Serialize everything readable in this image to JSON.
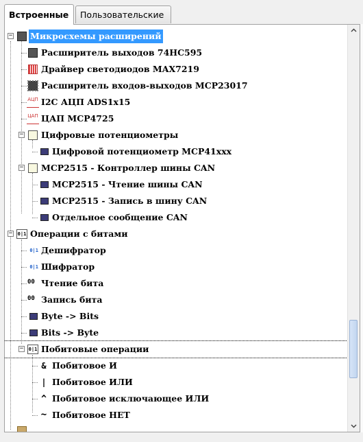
{
  "tabs": [
    {
      "label": "Встроенные",
      "active": true
    },
    {
      "label": "Пользовательские",
      "active": false
    }
  ],
  "tree": {
    "items": [
      {
        "label": "Микросхемы расширений",
        "icon": "chip-group-icon",
        "expanded": true
      },
      {
        "label": "Расширитель выходов 74HC595",
        "icon": "chip-icon"
      },
      {
        "label": "Драйвер светодиодов MAX7219",
        "icon": "led-matrix-icon"
      },
      {
        "label": "Расширитель входов-выходов MCP23017",
        "icon": "chip-icon"
      },
      {
        "label": "I2C АЦП ADS1x15",
        "icon": "adc-icon",
        "icon_text": "АЦП"
      },
      {
        "label": "ЦАП MCP4725",
        "icon": "dac-icon",
        "icon_text": "ЦАП"
      },
      {
        "label": "Цифровые потенциометры",
        "icon": "folder-icon",
        "expanded": true
      },
      {
        "label": "Цифровой потенциометр MCP41xxx",
        "icon": "block-icon"
      },
      {
        "label": "MCP2515 - Контроллер шины CAN",
        "icon": "folder-icon",
        "expanded": true
      },
      {
        "label": "MCP2515 - Чтение шины CAN",
        "icon": "block-icon"
      },
      {
        "label": "MCP2515 - Запись в шину CAN",
        "icon": "block-icon"
      },
      {
        "label": "Отдельное сообщение CAN",
        "icon": "block-icon"
      },
      {
        "label": "Операции с битами",
        "icon": "bits-group-icon",
        "expanded": true
      },
      {
        "label": "Дешифратор",
        "icon": "decoder-icon"
      },
      {
        "label": "Шифратор",
        "icon": "encoder-icon"
      },
      {
        "label": "Чтение бита",
        "icon": "bit-read-icon"
      },
      {
        "label": "Запись бита",
        "icon": "bit-write-icon"
      },
      {
        "label": "Byte -> Bits",
        "icon": "block-icon"
      },
      {
        "label": "Bits -> Byte",
        "icon": "block-icon"
      },
      {
        "label": "Побитовые операции",
        "icon": "bits-group-icon",
        "expanded": true
      },
      {
        "label": "Побитовое И",
        "icon": "and-icon",
        "icon_text": "&"
      },
      {
        "label": "Побитовое ИЛИ",
        "icon": "or-icon",
        "icon_text": "|"
      },
      {
        "label": "Побитовое исключающее ИЛИ",
        "icon": "xor-icon",
        "icon_text": "^"
      },
      {
        "label": "Побитовое НЕТ",
        "icon": "not-icon",
        "icon_text": "~"
      }
    ],
    "selected_label": "Микросхемы расширений",
    "focused_label": "Побитовые операции"
  },
  "icon_glyphs": {
    "bits": "0|1",
    "decoder": "0|1",
    "bit_read": "00",
    "bit_write": "00",
    "expand_collapse": "−"
  },
  "colors": {
    "selection": "#3399ff",
    "selection_text": "#ffffff",
    "panel_bg": "#ffffff",
    "tree_lines": "#808080"
  }
}
